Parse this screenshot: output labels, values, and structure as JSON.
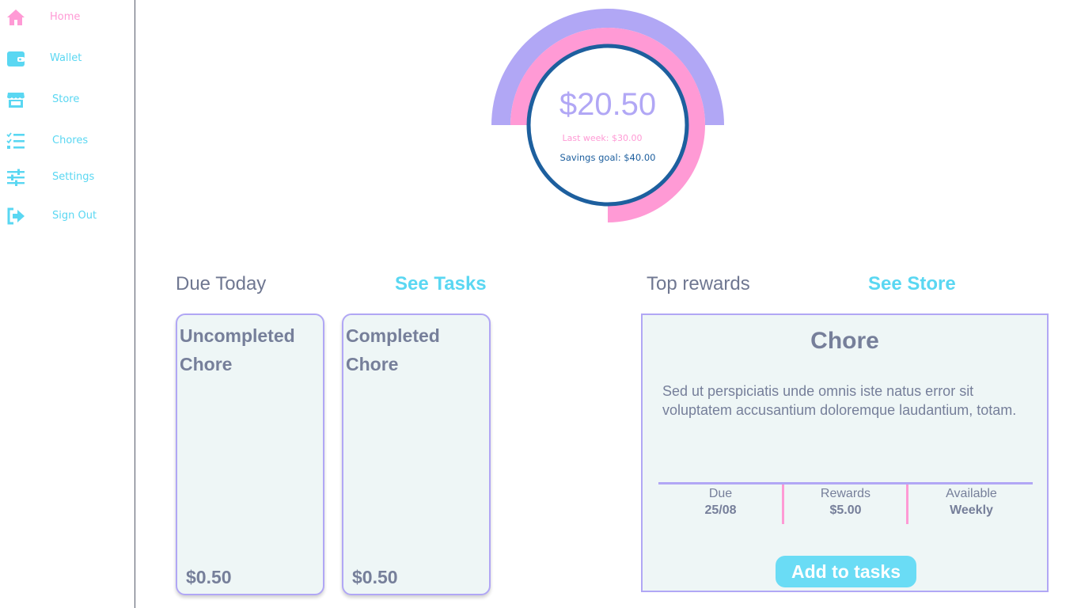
{
  "colors": {
    "accent_cyan": "#5ad7f2",
    "accent_pink": "#ff9ad5",
    "accent_lavender": "#b1a7f5",
    "accent_blue": "#1d5f9e",
    "text_gray": "#767f9a",
    "card_bg": "#eef6f6"
  },
  "sidebar": {
    "items": [
      {
        "label": "Home",
        "icon": "home-icon",
        "active": true
      },
      {
        "label": "Wallet",
        "icon": "wallet-icon"
      },
      {
        "label": "Store",
        "icon": "store-icon"
      },
      {
        "label": "Chores",
        "icon": "checklist-icon"
      },
      {
        "label": "Settings",
        "icon": "sliders-icon"
      },
      {
        "label": "Sign Out",
        "icon": "sign-out-icon"
      }
    ]
  },
  "balance": {
    "amount": "$20.50",
    "last_week": "Last week: $30.00",
    "savings_goal": "Savings goal: $40.00",
    "current_value": 20.5,
    "last_week_value": 30.0,
    "goal_value": 40.0
  },
  "due_today": {
    "title": "Due Today",
    "link": "See Tasks",
    "chores": [
      {
        "title": "Uncompleted Chore",
        "price": "$0.50"
      },
      {
        "title": "Completed Chore",
        "price": "$0.50"
      }
    ]
  },
  "top_rewards": {
    "title": "Top rewards",
    "link": "See Store",
    "card": {
      "title": "Chore",
      "description": "Sed ut perspiciatis unde omnis iste natus error sit voluptatem accusantium doloremque laudantium, totam.",
      "stats": [
        {
          "label": "Due",
          "value": "25/08"
        },
        {
          "label": "Rewards",
          "value": "$5.00"
        },
        {
          "label": "Available",
          "value": "Weekly"
        }
      ],
      "button": "Add to tasks"
    }
  }
}
